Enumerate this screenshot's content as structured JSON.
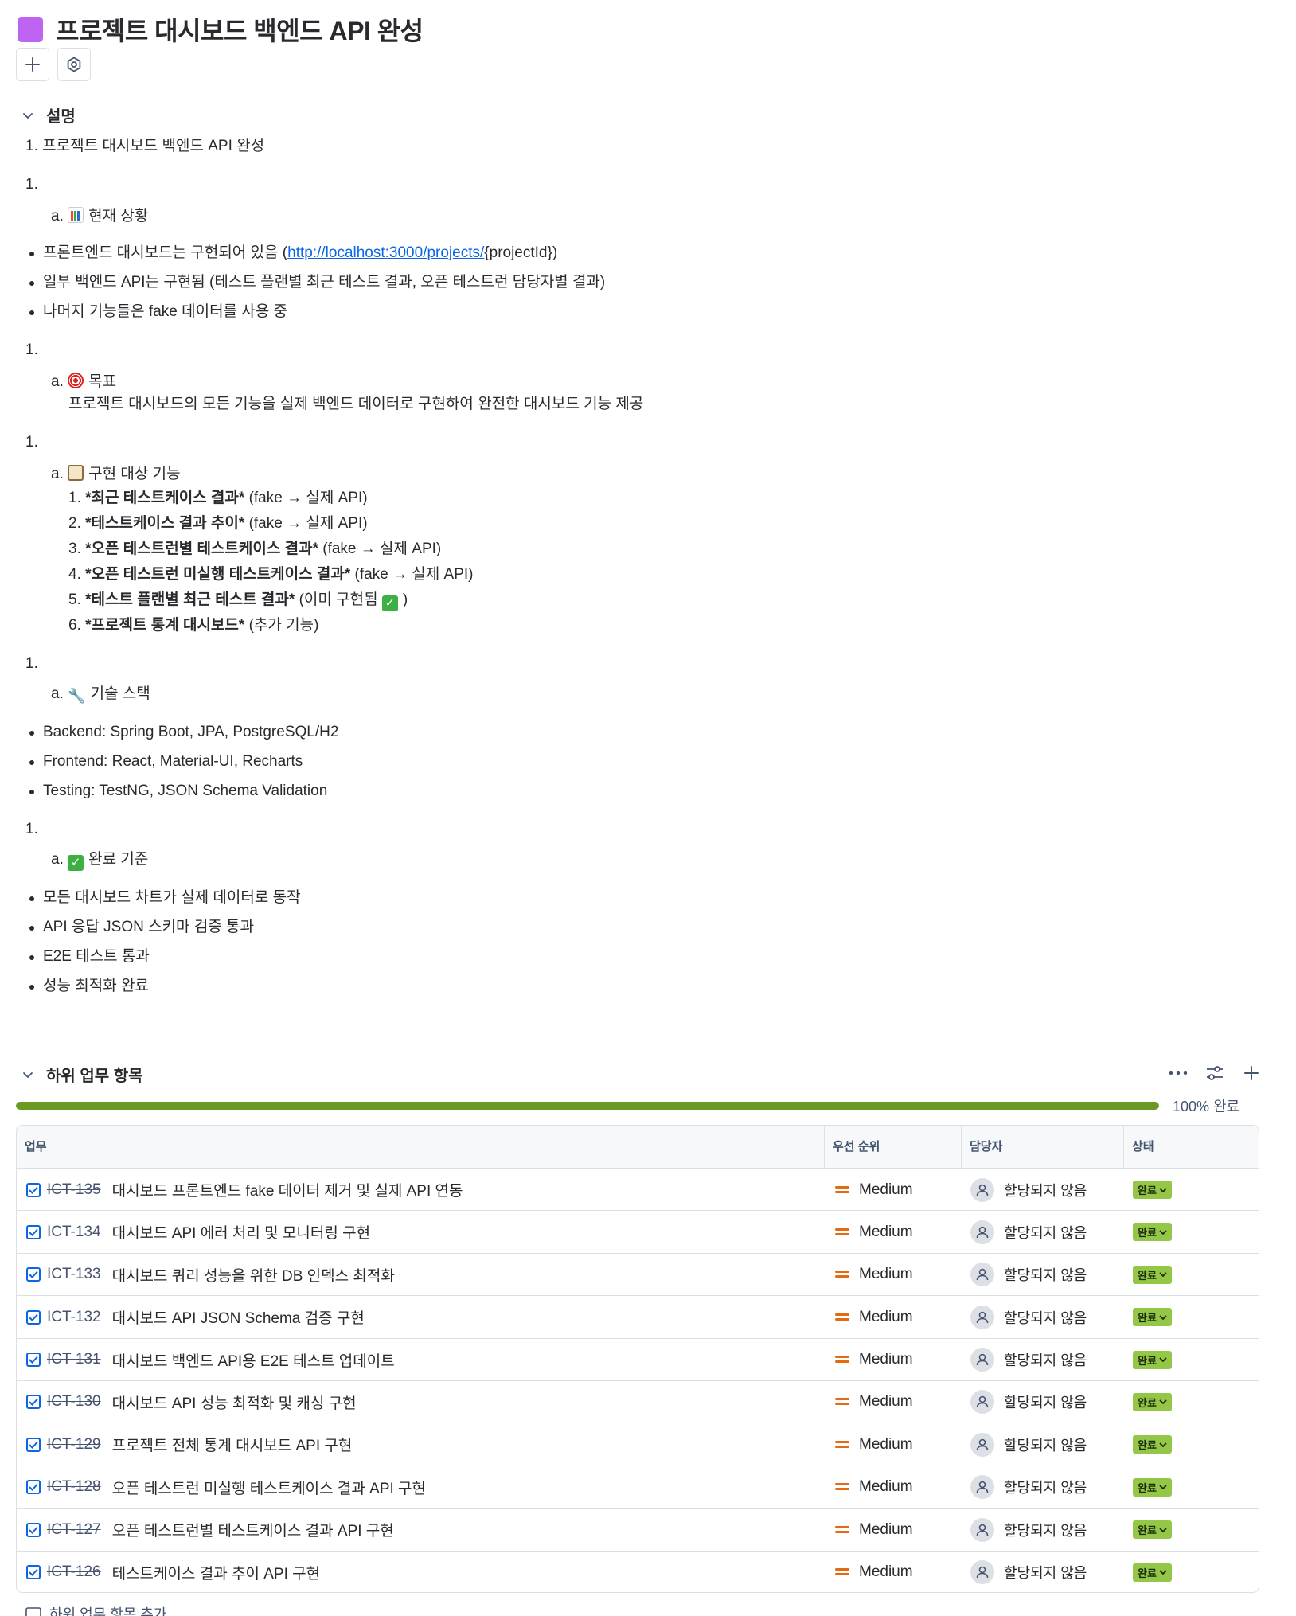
{
  "page": {
    "title": "프로젝트 대시보드 백엔드 API 완성"
  },
  "toolbar": {
    "add_icon": "plus-icon",
    "settings_icon": "hexagon-gear-icon"
  },
  "description": {
    "heading": "설명",
    "lines": {
      "l1": "1. 프로젝트 대시보드 백엔드 API 완성",
      "l2": "1.",
      "l3_prefix": "a.",
      "l3_text": "현재 상황",
      "b1_pre": "프론트엔드 대시보드는 구현되어 있음 (",
      "b1_link": "http://localhost:3000/projects/",
      "b1_post": "{projectId})",
      "b2": "일부 백엔드 API는 구현됨 (테스트 플랜별 최근 테스트 결과, 오픈 테스트런 담당자별 결과)",
      "b3": "나머지 기능들은 fake 데이터를 사용 중",
      "l4": "1.",
      "l5_prefix": "a.",
      "l5_text": "목표",
      "l6": "프로젝트 대시보드의 모든 기능을 실제 백엔드 데이터로 구현하여 완전한 대시보드 기능 제공",
      "l7": "1.",
      "l8_prefix": "a.",
      "l8_text": "구현 대상 기능",
      "f1_num": "1.",
      "f1_bold": "*최근 테스트케이스 결과*",
      "f1_rest": " (fake → 실제 API)",
      "f2_num": "2.",
      "f2_bold": "*테스트케이스 결과 추이*",
      "f2_rest": " (fake → 실제 API)",
      "f3_num": "3.",
      "f3_bold": "*오픈 테스트런별 테스트케이스 결과*",
      "f3_rest": " (fake → 실제 API)",
      "f4_num": "4.",
      "f4_bold": "*오픈 테스트런 미실행 테스트케이스 결과*",
      "f4_rest": " (fake → 실제 API)",
      "f5_num": "5.",
      "f5_bold": "*테스트 플랜별 최근 테스트 결과*",
      "f5_rest": " (이미 구현됨 ",
      "f5_end": ")",
      "f6_num": "6.",
      "f6_bold": "*프로젝트 통계 대시보드*",
      "f6_rest": " (추가 기능)",
      "l9": "1.",
      "l10_prefix": "a.",
      "l10_text": "기술 스택",
      "t1": "Backend: Spring Boot, JPA, PostgreSQL/H2",
      "t2": "Frontend: React, Material-UI, Recharts",
      "t3": "Testing: TestNG, JSON Schema Validation",
      "l11": "1.",
      "l12_prefix": "a.",
      "l12_text": "완료 기준",
      "c1": "모든 대시보드 차트가 실제 데이터로 동작",
      "c2": "API 응답 JSON 스키마 검증 통과",
      "c3": "E2E 테스트 통과",
      "c4": "성능 최적화 완료"
    }
  },
  "subtasks": {
    "heading": "하위 업무 항목",
    "progress_percent": 100,
    "progress_label": "100% 완료",
    "columns": {
      "work": "업무",
      "priority": "우선 순위",
      "assignee": "담당자",
      "status": "상태"
    },
    "rows": [
      {
        "key": "ICT-135",
        "summary": "대시보드 프론트엔드 fake 데이터 제거 및 실제 API 연동",
        "priority": "Medium",
        "assignee": "할당되지 않음",
        "status": "완료"
      },
      {
        "key": "ICT-134",
        "summary": "대시보드 API 에러 처리 및 모니터링 구현",
        "priority": "Medium",
        "assignee": "할당되지 않음",
        "status": "완료"
      },
      {
        "key": "ICT-133",
        "summary": "대시보드 쿼리 성능을 위한 DB 인덱스 최적화",
        "priority": "Medium",
        "assignee": "할당되지 않음",
        "status": "완료"
      },
      {
        "key": "ICT-132",
        "summary": "대시보드 API JSON Schema 검증 구현",
        "priority": "Medium",
        "assignee": "할당되지 않음",
        "status": "완료"
      },
      {
        "key": "ICT-131",
        "summary": "대시보드 백엔드 API용 E2E 테스트 업데이트",
        "priority": "Medium",
        "assignee": "할당되지 않음",
        "status": "완료"
      },
      {
        "key": "ICT-130",
        "summary": "대시보드 API 성능 최적화 및 캐싱 구현",
        "priority": "Medium",
        "assignee": "할당되지 않음",
        "status": "완료"
      },
      {
        "key": "ICT-129",
        "summary": "프로젝트 전체 통계 대시보드 API 구현",
        "priority": "Medium",
        "assignee": "할당되지 않음",
        "status": "완료"
      },
      {
        "key": "ICT-128",
        "summary": "오픈 테스트런 미실행 테스트케이스 결과 API 구현",
        "priority": "Medium",
        "assignee": "할당되지 않음",
        "status": "완료"
      },
      {
        "key": "ICT-127",
        "summary": "오픈 테스트런별 테스트케이스 결과 API 구현",
        "priority": "Medium",
        "assignee": "할당되지 않음",
        "status": "완료"
      },
      {
        "key": "ICT-126",
        "summary": "테스트케이스 결과 추이 API 구현",
        "priority": "Medium",
        "assignee": "할당되지 않음",
        "status": "완료"
      }
    ],
    "add_label": "하위 업무 항목 추가"
  },
  "colors": {
    "title_icon": "#bf63f3",
    "progress": "#6a9a23",
    "status_done": "#94c748",
    "link": "#0c66e4",
    "priority_medium": "#e56910"
  }
}
